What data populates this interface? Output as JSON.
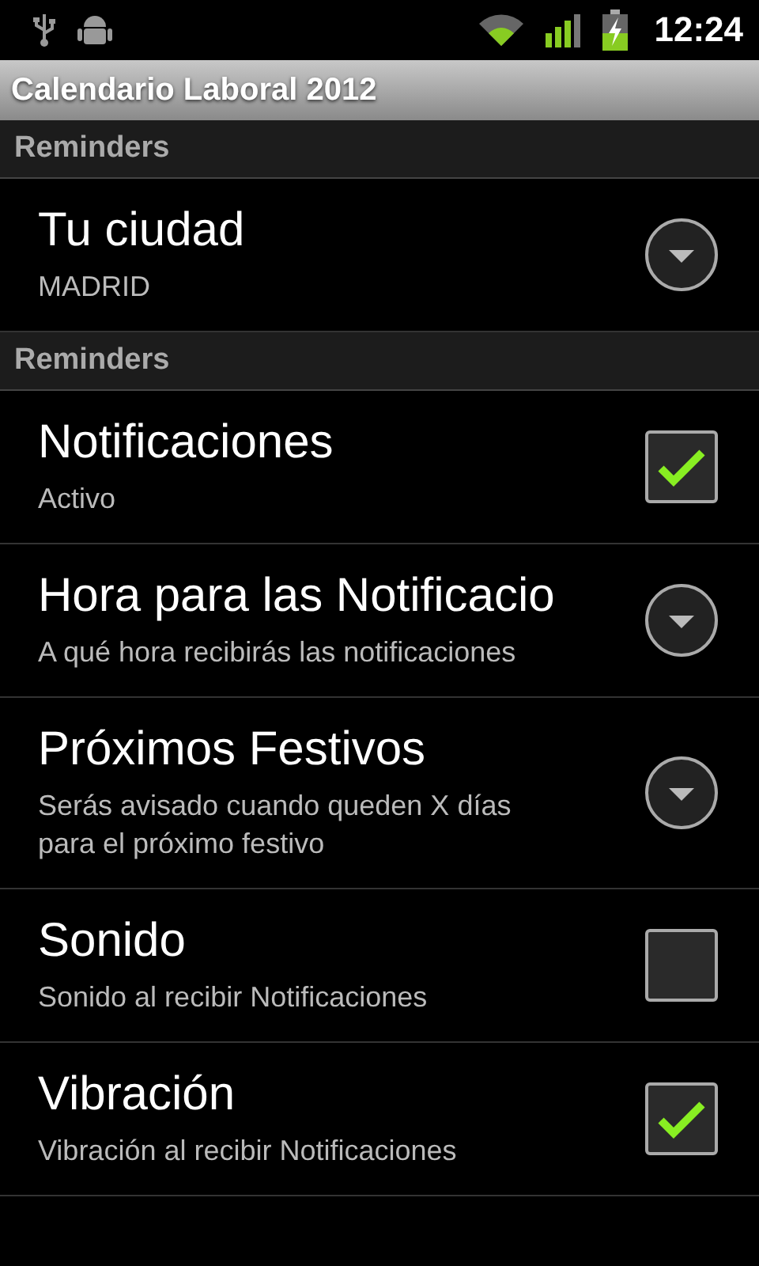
{
  "status_bar": {
    "time": "12:24"
  },
  "title_bar": {
    "title": "Calendario Laboral 2012"
  },
  "sections": [
    {
      "header": "Reminders",
      "items": [
        {
          "kind": "list",
          "title": "Tu ciudad",
          "summary": "MADRID"
        }
      ]
    },
    {
      "header": "Reminders",
      "items": [
        {
          "kind": "checkbox",
          "title": "Notificaciones",
          "summary": "Activo",
          "checked": true
        },
        {
          "kind": "list",
          "title": "Hora para las Notificacio",
          "summary": "A qué hora recibirás las notificaciones"
        },
        {
          "kind": "list",
          "title": "Próximos Festivos",
          "summary": "Serás avisado cuando queden X días para el próximo festivo"
        },
        {
          "kind": "checkbox",
          "title": "Sonido",
          "summary": "Sonido al recibir Notificaciones",
          "checked": false
        },
        {
          "kind": "checkbox",
          "title": "Vibración",
          "summary": "Vibración al recibir Notificaciones",
          "checked": true
        }
      ]
    }
  ]
}
